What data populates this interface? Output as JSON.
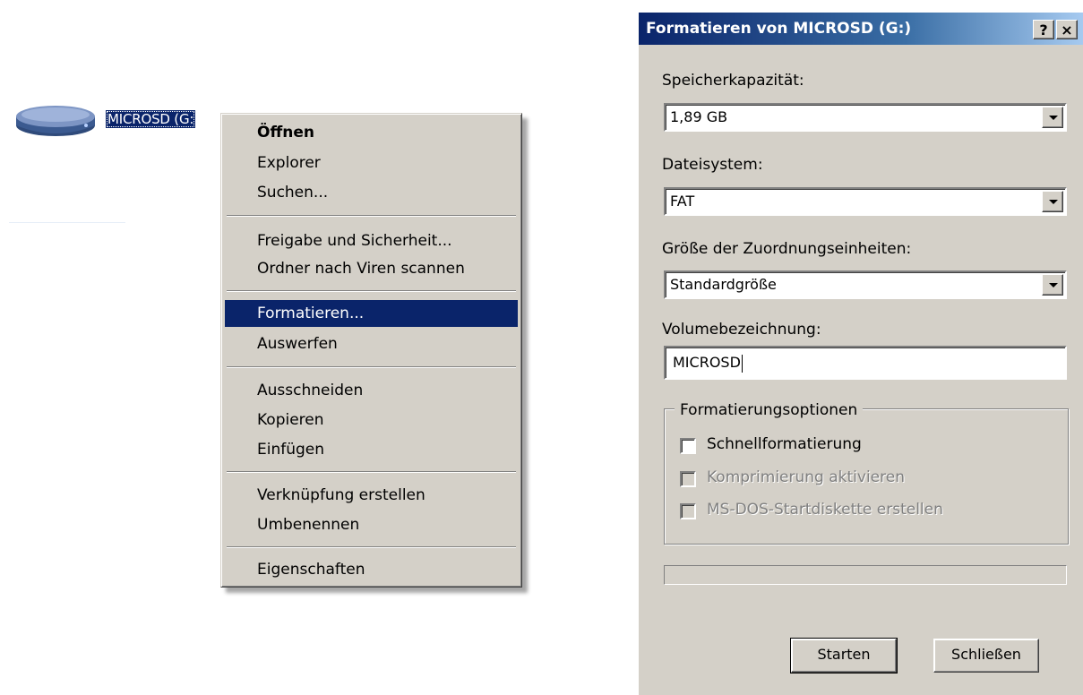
{
  "desktop": {
    "drive_label": "MICROSD (G:",
    "drive_icon": "removable-drive-icon"
  },
  "context_menu": {
    "items": [
      {
        "label": "Öffnen",
        "bold": true
      },
      {
        "label": "Explorer"
      },
      {
        "label": "Suchen..."
      },
      {
        "label": "Freigabe und Sicherheit..."
      },
      {
        "label": "Ordner nach Viren scannen"
      },
      {
        "label": "Formatieren...",
        "highlighted": true
      },
      {
        "label": "Auswerfen"
      },
      {
        "label": "Ausschneiden"
      },
      {
        "label": "Kopieren"
      },
      {
        "label": "Einfügen"
      },
      {
        "label": "Verknüpfung erstellen"
      },
      {
        "label": "Umbenennen"
      },
      {
        "label": "Eigenschaften"
      }
    ],
    "highlight_color": "#0a246a"
  },
  "dialog": {
    "title": "Formatieren von MICROSD (G:)",
    "help_button": "?",
    "close_button": "×",
    "capacity": {
      "label": "Speicherkapazität:",
      "value": "1,89 GB"
    },
    "filesystem": {
      "label": "Dateisystem:",
      "value": "FAT"
    },
    "allocation": {
      "label": "Größe der Zuordnungseinheiten:",
      "value": "Standardgröße"
    },
    "volume": {
      "label": "Volumebezeichnung:",
      "value": "MICROSD"
    },
    "options": {
      "title": "Formatierungsoptionen",
      "quick": {
        "label": "Schnellformatierung",
        "checked": false,
        "enabled": true
      },
      "compress": {
        "label": "Komprimierung aktivieren",
        "checked": false,
        "enabled": false
      },
      "msdos": {
        "label": "MS-DOS-Startdiskette erstellen",
        "checked": false,
        "enabled": false
      }
    },
    "progress": 0,
    "start_button": "Starten",
    "close_label": "Schließen"
  }
}
